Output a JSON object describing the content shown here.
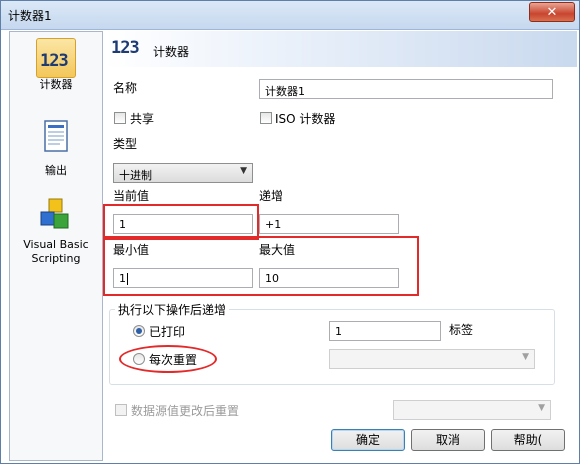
{
  "window": {
    "title": "计数器1",
    "close_glyph": "✕"
  },
  "sidebar": {
    "items": [
      {
        "label": "计数器",
        "icon": "counter-123-icon",
        "selected": true
      },
      {
        "label": "输出",
        "icon": "output-document-icon"
      },
      {
        "label": "Visual Basic Scripting",
        "icon": "vb-blocks-icon"
      }
    ]
  },
  "header": {
    "icon_text": "123",
    "title": "计数器"
  },
  "form": {
    "name_label": "名称",
    "name_value": "计数器1",
    "shared_label": "共享",
    "iso_label": "ISO 计数器",
    "type_label": "类型",
    "type_value": "十进制",
    "current_label": "当前值",
    "current_value": "1",
    "increment_label": "递增",
    "increment_value": "+1",
    "min_label": "最小值",
    "min_value": "1",
    "max_label": "最大值",
    "max_value": "10",
    "group_title": "执行以下操作后递增",
    "printed_label": "已打印",
    "printed_value": "1",
    "tag_label": "标签",
    "reset_label": "每次重置",
    "datasource_label": "数据源值更改后重置"
  },
  "buttons": {
    "ok": "确定",
    "cancel": "取消",
    "help": "帮助("
  },
  "colors": {
    "annotation": "#e32a2a",
    "accent": "#2d5ea6"
  }
}
